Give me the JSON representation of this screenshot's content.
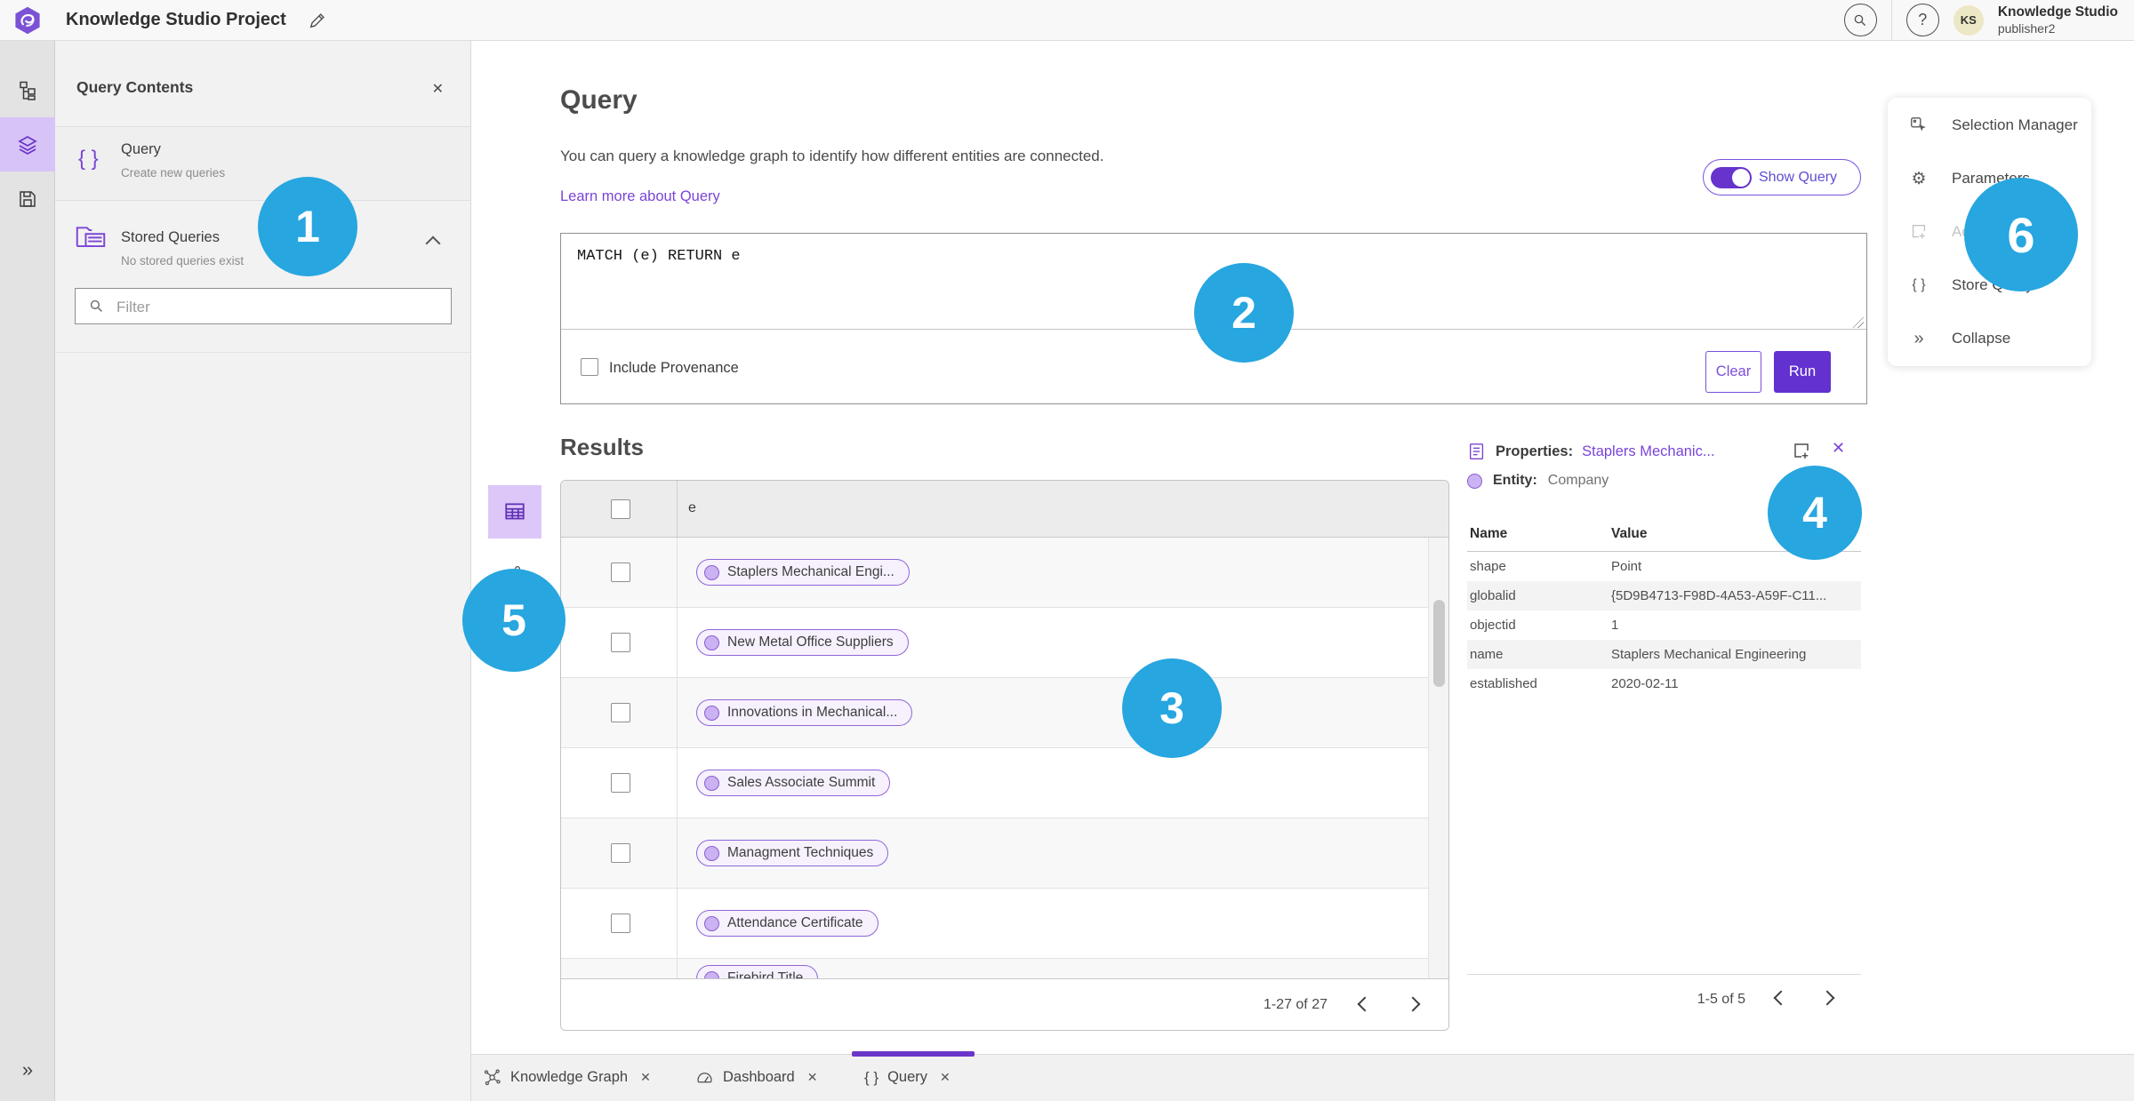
{
  "header": {
    "title": "Knowledge Studio Project",
    "avatar_initials": "KS",
    "user_name": "Knowledge Studio",
    "user_role": "publisher2"
  },
  "left_panel": {
    "title": "Query Contents",
    "query_item": {
      "label": "Query",
      "sublabel": "Create new queries"
    },
    "stored_item": {
      "label": "Stored Queries",
      "sublabel": "No stored queries exist"
    },
    "filter_placeholder": "Filter"
  },
  "query_section": {
    "title": "Query",
    "description": "You can query a knowledge graph to identify how different entities are connected.",
    "link": "Learn more about Query",
    "toggle_label": "Show Query",
    "query_text": "MATCH (e) RETURN e",
    "provenance_label": "Include Provenance",
    "clear_label": "Clear",
    "run_label": "Run"
  },
  "results": {
    "title": "Results",
    "column_header": "e",
    "rows": [
      "Staplers Mechanical Engi...",
      "New Metal Office Suppliers",
      "Innovations in Mechanical...",
      "Sales Associate Summit",
      "Managment Techniques",
      "Attendance Certificate",
      "Firebird Title"
    ],
    "pagination": "1-27 of 27"
  },
  "properties": {
    "title": "Properties:",
    "entity_link": "Staplers Mechanic...",
    "entity_label": "Entity:",
    "entity_type": "Company",
    "col_name": "Name",
    "col_value": "Value",
    "rows": [
      [
        "shape",
        "Point"
      ],
      [
        "globalid",
        "{5D9B4713-F98D-4A53-A59F-C11..."
      ],
      [
        "objectid",
        "1"
      ],
      [
        "name",
        "Staplers Mechanical Engineering"
      ],
      [
        "established",
        "2020-02-11"
      ]
    ],
    "pagination": "1-5 of 5"
  },
  "right_menu": {
    "items": [
      "Selection Manager",
      "Parameters",
      "Ad",
      "Store Query",
      "Collapse"
    ]
  },
  "tabs": {
    "items": [
      {
        "label": "Knowledge Graph"
      },
      {
        "label": "Dashboard"
      },
      {
        "label": "Query"
      }
    ]
  },
  "annotations": {
    "labels": [
      "1",
      "2",
      "3",
      "4",
      "5",
      "6"
    ]
  },
  "icons": {
    "close_x": "✕",
    "double_chevron_right": "»",
    "braces": "{ }",
    "gear": "⚙",
    "question_mark": "?"
  },
  "colors": {
    "accent": "#7a45d8",
    "run_button": "#6231d0",
    "toggle_on": "#6633cc",
    "annotation_blue": "#27a6e0",
    "rail_selected": "#d8c3f6",
    "avatar_bg": "#ece7c4"
  }
}
